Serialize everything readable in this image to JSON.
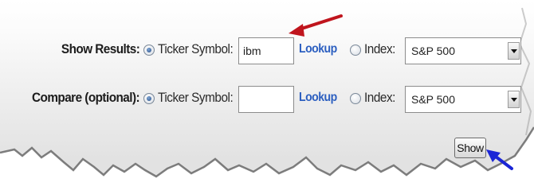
{
  "form": {
    "row1": {
      "label": "Show Results:",
      "ticker_label": "Ticker Symbol:",
      "ticker_value": "ibm",
      "lookup": "Lookup",
      "index_label": "Index:",
      "index_value": "S&P 500",
      "selected": "ticker"
    },
    "row2": {
      "label": "Compare (optional):",
      "ticker_label": "Ticker Symbol:",
      "ticker_value": "",
      "lookup": "Lookup",
      "index_label": "Index:",
      "index_value": "S&P 500",
      "selected": "ticker"
    },
    "show_button": "Show"
  },
  "annotations": {
    "red_arrow_color": "#c0151d",
    "blue_arrow_color": "#1a25d6"
  }
}
